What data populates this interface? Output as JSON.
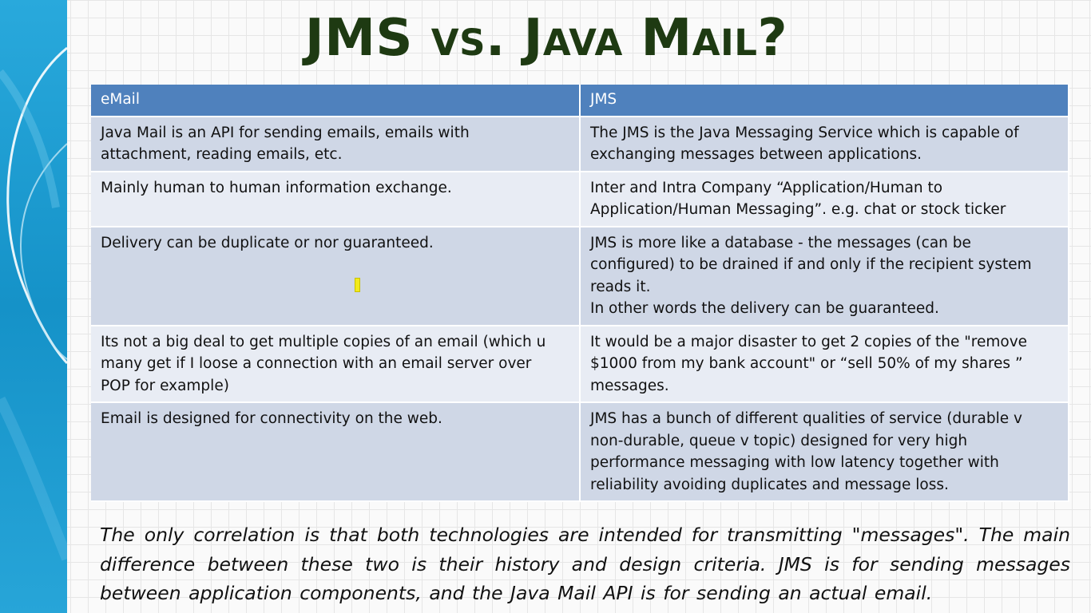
{
  "slide": {
    "title": "JMS vs. Java Mail?",
    "theme": {
      "header_color": "#4f81bd",
      "row_dark": "#cfd7e6",
      "row_light": "#e8ecf4",
      "title_color": "#1e3a12",
      "band_color": "#1a9bd0"
    }
  },
  "table": {
    "headers": [
      "eMail",
      "JMS"
    ],
    "rows": [
      [
        "Java Mail is an API for sending emails, emails with\nattachment, reading emails, etc.",
        "The JMS is the Java Messaging Service which is capable of\nexchanging messages between applications."
      ],
      [
        "Mainly human to  human information exchange.",
        "Inter and Intra Company “Application/Human to\nApplication/Human Messaging”.  e.g. chat or stock ticker"
      ],
      [
        "Delivery can be duplicate or nor guaranteed.",
        "JMS is more like a database - the messages (can be\nconfigured) to be drained if and only if the recipient system\nreads it.\nIn other words the delivery can be guaranteed."
      ],
      [
        "Its not a big deal to get multiple copies of an email (which u\nmany get if I loose a connection with an email server over\nPOP for example)",
        "It would be a major disaster to get 2 copies of the \"remove\n$1000 from my bank account\" or “sell 50% of my shares ”\nmessages."
      ],
      [
        "Email is designed for connectivity on the web.",
        "JMS has a bunch of different qualities of service (durable v\nnon-durable, queue v topic) designed for very high\nperformance messaging with low latency together with\nreliability avoiding duplicates and message loss."
      ]
    ]
  },
  "summary": "The only correlation is that both technologies are intended for transmitting \"messages\". The main difference between these two is their history and design criteria. JMS is for sending messages between application components, and the Java Mail API is for sending an actual email."
}
